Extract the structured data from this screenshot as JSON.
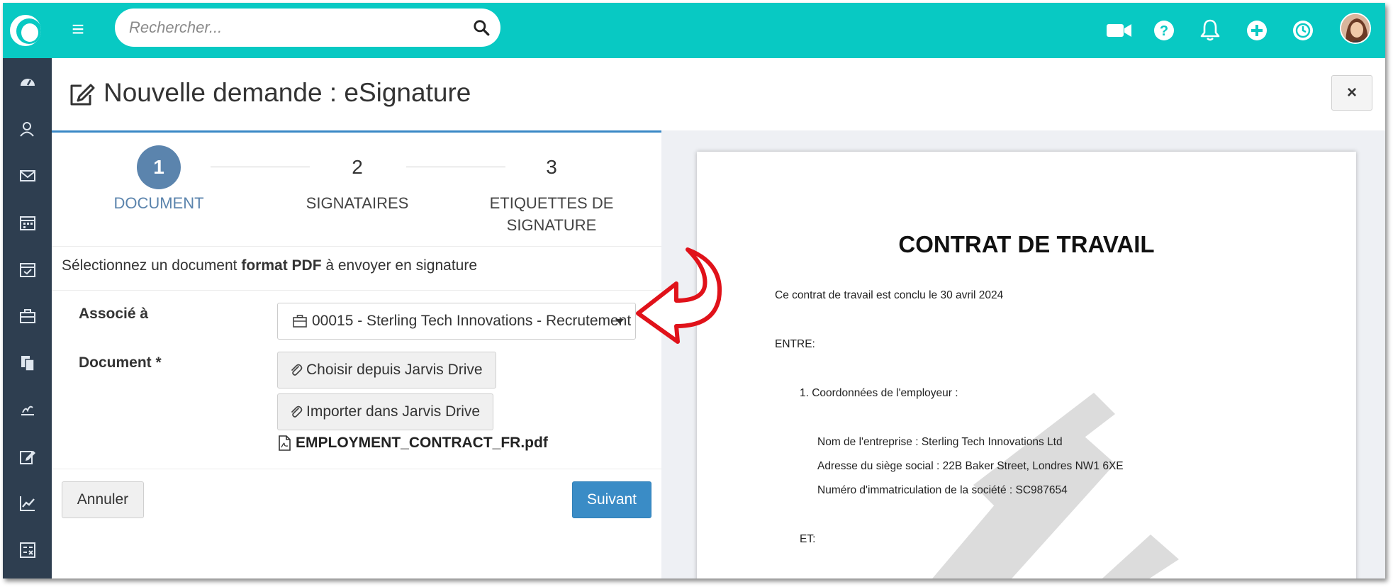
{
  "topbar": {
    "search_placeholder": "Rechercher...",
    "icons": [
      "logo-icon",
      "menu-icon",
      "search-icon",
      "video-camera-icon",
      "help-icon",
      "bell-icon",
      "plus-circle-icon",
      "clock-icon",
      "user-avatar"
    ],
    "accent_color": "#08c9c3"
  },
  "sidebar": {
    "items": [
      {
        "icon": "dashboard-icon"
      },
      {
        "icon": "contacts-icon"
      },
      {
        "icon": "mail-icon"
      },
      {
        "icon": "calendar-icon"
      },
      {
        "icon": "calendar-check-icon"
      },
      {
        "icon": "briefcase-icon"
      },
      {
        "icon": "documents-icon"
      },
      {
        "icon": "signature-icon"
      },
      {
        "icon": "edit-icon"
      },
      {
        "icon": "chart-icon"
      },
      {
        "icon": "calculator-icon"
      }
    ],
    "background_color": "#2e3e50"
  },
  "page": {
    "title": "Nouvelle demande : eSignature",
    "close_label": "×"
  },
  "steps": [
    {
      "number": "1",
      "label": "DOCUMENT",
      "active": true
    },
    {
      "number": "2",
      "label": "SIGNATAIRES",
      "active": false
    },
    {
      "number": "3",
      "label_line1": "ETIQUETTES DE",
      "label_line2": "SIGNATURE",
      "active": false
    }
  ],
  "form": {
    "intro_before": "Sélectionnez un document ",
    "intro_bold": "format PDF",
    "intro_after": " à envoyer en signature",
    "associated_label": "Associé à",
    "associated_value": "00015 - Sterling Tech Innovations - Recrutement",
    "document_label": "Document *",
    "choose_drive_label": "Choisir depuis Jarvis Drive",
    "import_drive_label": "Importer dans Jarvis Drive",
    "file_name": "EMPLOYMENT_CONTRACT_FR.pdf",
    "cancel_label": "Annuler",
    "next_label": "Suivant",
    "primary_color": "#3a8cc6",
    "active_step_color": "#5b84ad"
  },
  "preview": {
    "title": "CONTRAT DE TRAVAIL",
    "intro": "Ce contrat de travail est conclu le 30 avril 2024",
    "between": "ENTRE:",
    "section1": "1.   Coordonnées de l'employeur :",
    "company": "Nom de l'entreprise : Sterling Tech Innovations Ltd",
    "address": "Adresse du siège social : 22B Baker Street, Londres NW1 6XE",
    "registration": "Numéro d'immatriculation de la société : SC987654",
    "and": "ET:"
  },
  "annotation": {
    "arrow_color": "#e0121a"
  }
}
